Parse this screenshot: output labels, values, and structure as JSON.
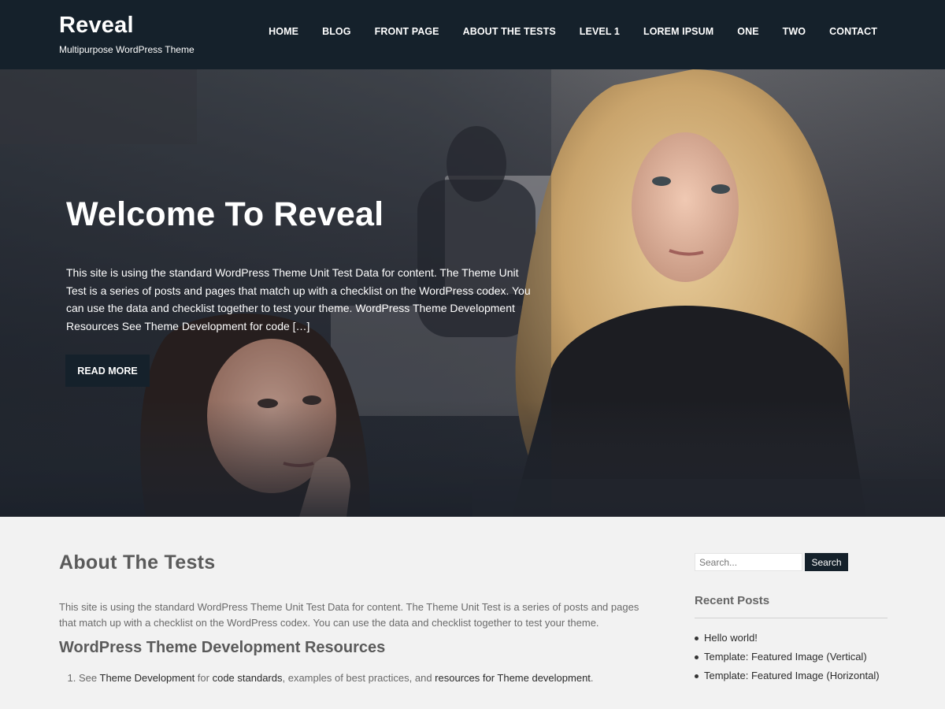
{
  "header": {
    "site_title": "Reveal",
    "site_description": "Multipurpose WordPress Theme",
    "nav": [
      "HOME",
      "BLOG",
      "FRONT PAGE",
      "ABOUT THE TESTS",
      "LEVEL 1",
      "LOREM IPSUM",
      "ONE",
      "TWO",
      "CONTACT"
    ]
  },
  "hero": {
    "title": "Welcome To Reveal",
    "text": "This site is using the standard WordPress Theme Unit Test Data for content. The Theme Unit Test is a series of posts and pages that match up with a checklist on the WordPress codex. You can use the data and checklist together to test your theme. WordPress Theme Development Resources See Theme Development for code […]",
    "button_label": "READ MORE"
  },
  "content": {
    "title": "About The Tests",
    "intro": "This site is using the standard WordPress Theme Unit Test Data for content. The Theme Unit Test is a series of posts and pages that match up with a checklist on the WordPress codex. You can use the data and checklist together to test your theme.",
    "subtitle": "WordPress Theme Development Resources",
    "list_item_1": {
      "prefix": "See ",
      "link1": "Theme Development",
      "mid1": " for ",
      "link2": "code standards",
      "mid2": ", examples of best practices, and ",
      "link3": "resources for Theme development",
      "suffix": "."
    }
  },
  "sidebar": {
    "search_placeholder": "Search...",
    "search_button": "Search",
    "recent_title": "Recent Posts",
    "recent_posts": [
      "Hello world!",
      "Template: Featured Image (Vertical)",
      "Template: Featured Image (Horizontal)"
    ]
  },
  "colors": {
    "header_bg": "#15212b",
    "button_bg": "#15212b",
    "page_bg": "#f2f2f2"
  }
}
